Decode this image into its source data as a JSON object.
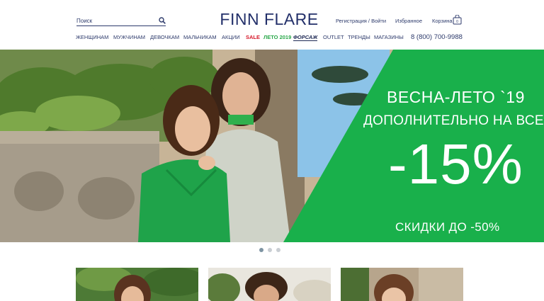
{
  "header": {
    "search_placeholder": "Поиск",
    "logo": "FINN FLARE",
    "register_login": "Регистрация / Войти",
    "favorites": "Избранное",
    "cart": "Корзина",
    "phone": "8 (800) 700-9988"
  },
  "nav": {
    "items": [
      {
        "label": "ЖЕНЩИНАМ"
      },
      {
        "label": "МУЖЧИНАМ"
      },
      {
        "label": "ДЕВОЧКАМ"
      },
      {
        "label": "МАЛЬЧИКАМ"
      },
      {
        "label": "АКЦИИ"
      },
      {
        "label": "SALE",
        "color": "#d6192b"
      },
      {
        "label": "ЛЕТО 2019",
        "color": "#2aa84a"
      },
      {
        "label": "ФОРСАЖ"
      },
      {
        "label": "OUTLET"
      },
      {
        "label": "ТРЕНДЫ"
      },
      {
        "label": "МАГАЗИНЫ"
      }
    ]
  },
  "hero": {
    "line1": "ВЕСНА-ЛЕТО `19",
    "line2": "ДОПОЛНИТЕЛЬНО НА ВСЕ",
    "discount": "-15%",
    "line3": "СКИДКИ ДО -50%",
    "accent_color": "#19b04b"
  },
  "carousel": {
    "slides": 3,
    "active": 1
  },
  "icons": [
    "search-icon",
    "cart-icon"
  ],
  "colors": {
    "brand_navy": "#23306a",
    "sale_red": "#d6192b",
    "promo_green": "#19b04b"
  }
}
